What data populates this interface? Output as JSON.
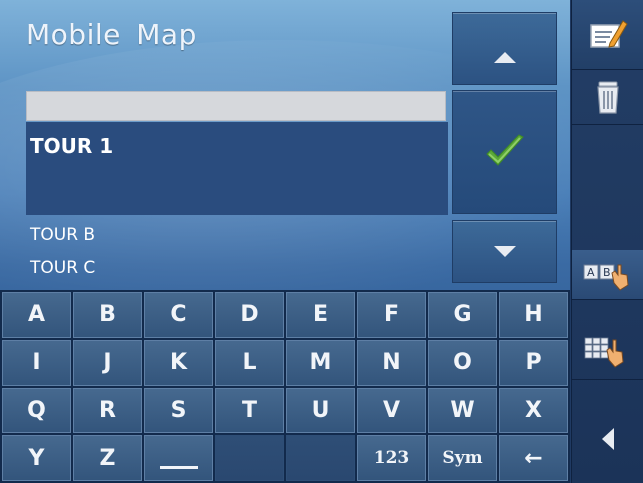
{
  "app": {
    "title": "Mobile Map"
  },
  "search": {
    "value": ""
  },
  "list": {
    "selected": "TOUR 1",
    "items": [
      "TOUR B",
      "TOUR C"
    ]
  },
  "nav": {
    "up_icon": "triangle-up-icon",
    "confirm_icon": "green-checkmark-icon",
    "down_icon": "triangle-down-icon"
  },
  "keyboard": {
    "rows": [
      [
        "A",
        "B",
        "C",
        "D",
        "E",
        "F",
        "G",
        "H"
      ],
      [
        "I",
        "J",
        "K",
        "L",
        "M",
        "N",
        "O",
        "P"
      ],
      [
        "Q",
        "R",
        "S",
        "T",
        "U",
        "V",
        "W",
        "X"
      ],
      [
        "Y",
        "Z",
        "_",
        "",
        "",
        "123",
        "Sym",
        "←"
      ]
    ]
  },
  "sidebar": {
    "icons": [
      "edit-note-icon",
      "trash-icon",
      "ab-keyboard-mode-icon",
      "numeric-grid-mode-icon",
      "back-arrow-icon"
    ]
  },
  "colors": {
    "checkmark": "#5aa83a",
    "selection": "#2a4c7e",
    "background": "#4a7fb8"
  }
}
